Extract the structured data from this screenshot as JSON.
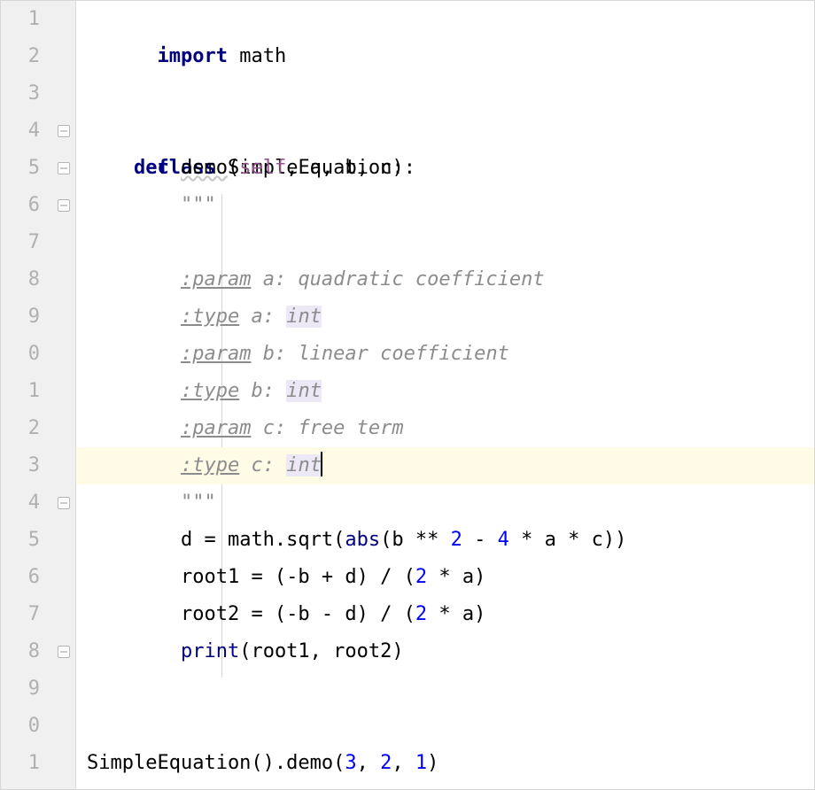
{
  "editor": {
    "line_height": 42,
    "line_numbers": [
      "1",
      "2",
      "3",
      "4",
      "5",
      "6",
      "7",
      "8",
      "9",
      "0",
      "1",
      "2",
      "3",
      "4",
      "5",
      "6",
      "7",
      "8",
      "9",
      "0",
      "1"
    ],
    "fold_lines": [
      4,
      5,
      6,
      14,
      18
    ],
    "current_line_index": 12
  },
  "tokens": {
    "import_kw": "import",
    "math_mod": "math",
    "class_kw": "class",
    "class_name": "SimpleEquation",
    "colon": ":",
    "def_kw": "def",
    "def_name": "demo",
    "self": "self",
    "a": "a",
    "b": "b",
    "c": "c",
    "triple_quote": "\"\"\"",
    "param_tag": ":param",
    "type_tag": ":type",
    "doc_a_desc": "a: quadratic coefficient",
    "doc_a_type_lbl": "a:",
    "doc_b_desc": "b: linear coefficient",
    "doc_b_type_lbl": "b:",
    "doc_c_desc": "c: free term",
    "doc_c_type_lbl": "c:",
    "int_ty": "int",
    "d_eq": "d = math.sqrt(",
    "abs_fn": "abs",
    "after_abs": "(b ** ",
    "two": "2",
    "minus": " - ",
    "four": "4",
    "star_a_star_c": " * a * c))",
    "root1_pre": "root1 = (-b + d) / (",
    "root2_pre": "root2 = (-b - d) / (",
    "star_a_close": " * a)",
    "print_fn": "print",
    "print_args": "(root1, root2)",
    "call_pre": "SimpleEquation().demo(",
    "three": "3",
    "comma_sp": ", ",
    "one": "1",
    "close_paren": ")"
  }
}
